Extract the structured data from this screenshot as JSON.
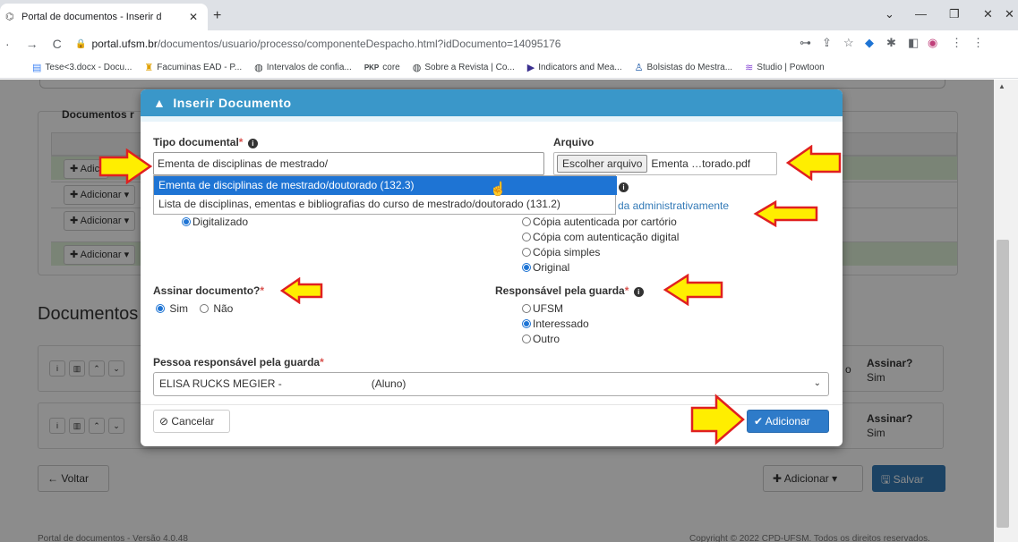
{
  "browser": {
    "tab_title": "Portal de documentos - Inserir d",
    "url_domain": "portal.ufsm.br",
    "url_path": "/documentos/usuario/processo/componenteDespacho.html?idDocumento=14095176",
    "bookmarks": [
      {
        "icon": "doc-icon",
        "label": "Tese<3.docx - Docu..."
      },
      {
        "icon": "hat-icon",
        "label": "Facuminas EAD - P..."
      },
      {
        "icon": "globe-icon",
        "label": "Intervalos de confia..."
      },
      {
        "icon": "pkp-icon",
        "label": "core"
      },
      {
        "icon": "globe-icon",
        "label": "Sobre a Revista | Co..."
      },
      {
        "icon": "play-icon",
        "label": "Indicators and Mea..."
      },
      {
        "icon": "ufsm-icon",
        "label": "Bolsistas do Mestra..."
      },
      {
        "icon": "studio-icon",
        "label": "Studio | Powtoon"
      }
    ],
    "bm_pkp": "PKP"
  },
  "background": {
    "panel_title": "Documentos r",
    "add_label": "Adicionar",
    "add_short": "Adici",
    "section_title": "Documentos",
    "assinar_label": "Assinar?",
    "assinar_value": "Sim",
    "side_letter": "o",
    "voltar": "Voltar",
    "adicionar": "Adicionar",
    "salvar": "Salvar",
    "footer_left": "Portal de documentos - Versão 4.0.48",
    "footer_right": "Copyright © 2022 CPD-UFSM. Todos os direitos reservados."
  },
  "modal": {
    "title": "Inserir Documento",
    "tipo_label": "Tipo documental",
    "tipo_value": "Ementa de disciplinas de mestrado/",
    "arquivo_label": "Arquivo",
    "file_button": "Escolher arquivo",
    "file_name": "Ementa …torado.pdf",
    "dropdown_options": [
      "Ementa de disciplinas de mestrado/doutorado (132.3)",
      "Lista de disciplinas, ementas e bibliografias do curso de mestrado/doutorado (131.2)"
    ],
    "formato_options": [
      "Digitalizado"
    ],
    "autenticacao_link": "da administrativamente",
    "autenticacao_options": [
      "Cópia autenticada por cartório",
      "Cópia com autenticação digital",
      "Cópia simples",
      "Original"
    ],
    "autenticacao_selected": "Original",
    "assinar_label": "Assinar documento?",
    "assinar_options": [
      "Sim",
      "Não"
    ],
    "assinar_selected": "Sim",
    "guarda_label": "Responsável pela guarda",
    "guarda_options": [
      "UFSM",
      "Interessado",
      "Outro"
    ],
    "guarda_selected": "Interessado",
    "pessoa_label": "Pessoa responsável pela guarda",
    "pessoa_value_name": "ELISA RUCKS MEGIER -",
    "pessoa_value_role": "(Aluno)",
    "cancelar": "Cancelar",
    "adicionar": "Adicionar"
  },
  "colors": {
    "modal_header": "#3a97c9",
    "primary_button": "#2e7bc9",
    "arrow_fill": "#ffee00",
    "arrow_stroke": "#e02020"
  }
}
